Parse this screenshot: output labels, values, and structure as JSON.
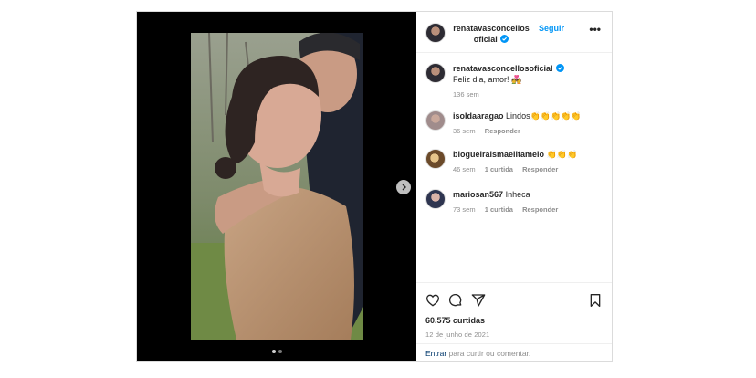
{
  "header": {
    "username": "renatavasconcellosoficial",
    "follow_label": "Seguir",
    "more_label": "•••"
  },
  "caption": {
    "username": "renatavasconcellosoficial",
    "text": "Feliz dia, amor! 💑",
    "time": "136 sem"
  },
  "comments": [
    {
      "username": "isoldaaragao",
      "text": "Lindos👏👏👏👏👏",
      "time": "36 sem",
      "likes": "",
      "reply_label": "Responder"
    },
    {
      "username": "blogueiraismaelitamelo",
      "text": "👏👏👏",
      "time": "46 sem",
      "likes": "1 curtida",
      "reply_label": "Responder"
    },
    {
      "username": "mariosan567",
      "text": "Inheca",
      "time": "73 sem",
      "likes": "1 curtida",
      "reply_label": "Responder"
    }
  ],
  "footer": {
    "likes": "60.575 curtidas",
    "date": "12 de junho de 2021",
    "comment_link": "Entrar",
    "comment_rest": " para curtir ou comentar."
  },
  "carousel": {
    "current": 1,
    "total": 2
  },
  "colors": {
    "accent": "#0095f6",
    "verified": "#0095f6",
    "muted": "#8e8e8e"
  },
  "icons": [
    "verified-icon",
    "heart-icon",
    "comment-icon",
    "share-icon",
    "save-icon",
    "next-arrow-icon",
    "more-icon"
  ]
}
